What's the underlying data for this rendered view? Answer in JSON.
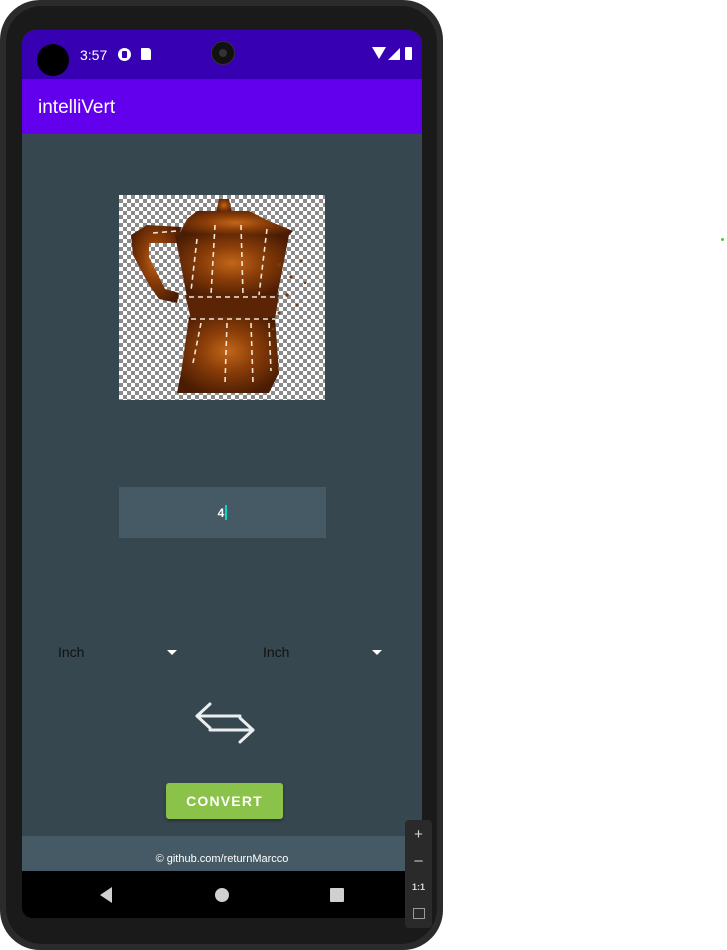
{
  "status": {
    "time": "3:57"
  },
  "app": {
    "title": "intelliVert"
  },
  "input": {
    "value": "4"
  },
  "from_unit": {
    "selected": "Inch"
  },
  "to_unit": {
    "selected": "Inch"
  },
  "convert": {
    "label": "CONVERT"
  },
  "footer": {
    "text": "© github.com/returnMarcco"
  },
  "emulator": {
    "zoom_in": "+",
    "zoom_out": "–",
    "actual_size": "1:1"
  },
  "image": {
    "subject": "moka pot (coffee maker) on transparent checkerboard"
  },
  "colors": {
    "status_bar": "#3700b3",
    "app_bar": "#6200ee",
    "background": "#37474f",
    "input_bg": "#455a64",
    "button": "#8bc34a",
    "cursor": "#03dac5"
  }
}
